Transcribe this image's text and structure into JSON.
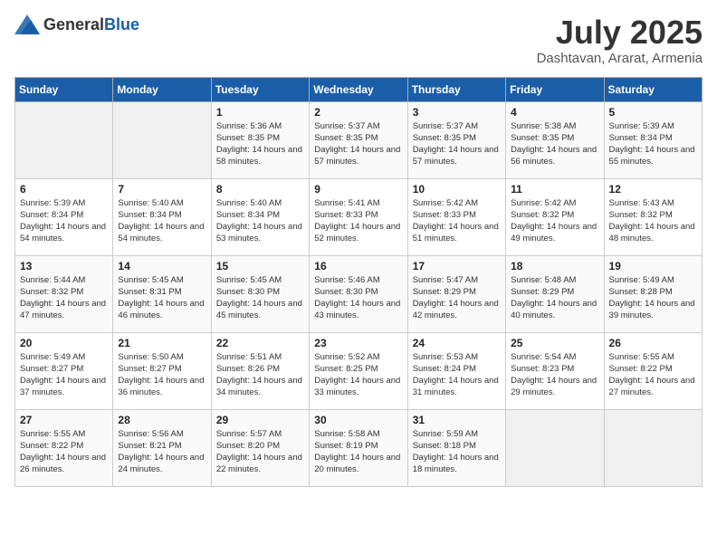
{
  "logo": {
    "general": "General",
    "blue": "Blue"
  },
  "header": {
    "month": "July 2025",
    "location": "Dashtavan, Ararat, Armenia"
  },
  "weekdays": [
    "Sunday",
    "Monday",
    "Tuesday",
    "Wednesday",
    "Thursday",
    "Friday",
    "Saturday"
  ],
  "weeks": [
    [
      {
        "day": "",
        "sunrise": "",
        "sunset": "",
        "daylight": ""
      },
      {
        "day": "",
        "sunrise": "",
        "sunset": "",
        "daylight": ""
      },
      {
        "day": "1",
        "sunrise": "Sunrise: 5:36 AM",
        "sunset": "Sunset: 8:35 PM",
        "daylight": "Daylight: 14 hours and 58 minutes."
      },
      {
        "day": "2",
        "sunrise": "Sunrise: 5:37 AM",
        "sunset": "Sunset: 8:35 PM",
        "daylight": "Daylight: 14 hours and 57 minutes."
      },
      {
        "day": "3",
        "sunrise": "Sunrise: 5:37 AM",
        "sunset": "Sunset: 8:35 PM",
        "daylight": "Daylight: 14 hours and 57 minutes."
      },
      {
        "day": "4",
        "sunrise": "Sunrise: 5:38 AM",
        "sunset": "Sunset: 8:35 PM",
        "daylight": "Daylight: 14 hours and 56 minutes."
      },
      {
        "day": "5",
        "sunrise": "Sunrise: 5:39 AM",
        "sunset": "Sunset: 8:34 PM",
        "daylight": "Daylight: 14 hours and 55 minutes."
      }
    ],
    [
      {
        "day": "6",
        "sunrise": "Sunrise: 5:39 AM",
        "sunset": "Sunset: 8:34 PM",
        "daylight": "Daylight: 14 hours and 54 minutes."
      },
      {
        "day": "7",
        "sunrise": "Sunrise: 5:40 AM",
        "sunset": "Sunset: 8:34 PM",
        "daylight": "Daylight: 14 hours and 54 minutes."
      },
      {
        "day": "8",
        "sunrise": "Sunrise: 5:40 AM",
        "sunset": "Sunset: 8:34 PM",
        "daylight": "Daylight: 14 hours and 53 minutes."
      },
      {
        "day": "9",
        "sunrise": "Sunrise: 5:41 AM",
        "sunset": "Sunset: 8:33 PM",
        "daylight": "Daylight: 14 hours and 52 minutes."
      },
      {
        "day": "10",
        "sunrise": "Sunrise: 5:42 AM",
        "sunset": "Sunset: 8:33 PM",
        "daylight": "Daylight: 14 hours and 51 minutes."
      },
      {
        "day": "11",
        "sunrise": "Sunrise: 5:42 AM",
        "sunset": "Sunset: 8:32 PM",
        "daylight": "Daylight: 14 hours and 49 minutes."
      },
      {
        "day": "12",
        "sunrise": "Sunrise: 5:43 AM",
        "sunset": "Sunset: 8:32 PM",
        "daylight": "Daylight: 14 hours and 48 minutes."
      }
    ],
    [
      {
        "day": "13",
        "sunrise": "Sunrise: 5:44 AM",
        "sunset": "Sunset: 8:32 PM",
        "daylight": "Daylight: 14 hours and 47 minutes."
      },
      {
        "day": "14",
        "sunrise": "Sunrise: 5:45 AM",
        "sunset": "Sunset: 8:31 PM",
        "daylight": "Daylight: 14 hours and 46 minutes."
      },
      {
        "day": "15",
        "sunrise": "Sunrise: 5:45 AM",
        "sunset": "Sunset: 8:30 PM",
        "daylight": "Daylight: 14 hours and 45 minutes."
      },
      {
        "day": "16",
        "sunrise": "Sunrise: 5:46 AM",
        "sunset": "Sunset: 8:30 PM",
        "daylight": "Daylight: 14 hours and 43 minutes."
      },
      {
        "day": "17",
        "sunrise": "Sunrise: 5:47 AM",
        "sunset": "Sunset: 8:29 PM",
        "daylight": "Daylight: 14 hours and 42 minutes."
      },
      {
        "day": "18",
        "sunrise": "Sunrise: 5:48 AM",
        "sunset": "Sunset: 8:29 PM",
        "daylight": "Daylight: 14 hours and 40 minutes."
      },
      {
        "day": "19",
        "sunrise": "Sunrise: 5:49 AM",
        "sunset": "Sunset: 8:28 PM",
        "daylight": "Daylight: 14 hours and 39 minutes."
      }
    ],
    [
      {
        "day": "20",
        "sunrise": "Sunrise: 5:49 AM",
        "sunset": "Sunset: 8:27 PM",
        "daylight": "Daylight: 14 hours and 37 minutes."
      },
      {
        "day": "21",
        "sunrise": "Sunrise: 5:50 AM",
        "sunset": "Sunset: 8:27 PM",
        "daylight": "Daylight: 14 hours and 36 minutes."
      },
      {
        "day": "22",
        "sunrise": "Sunrise: 5:51 AM",
        "sunset": "Sunset: 8:26 PM",
        "daylight": "Daylight: 14 hours and 34 minutes."
      },
      {
        "day": "23",
        "sunrise": "Sunrise: 5:52 AM",
        "sunset": "Sunset: 8:25 PM",
        "daylight": "Daylight: 14 hours and 33 minutes."
      },
      {
        "day": "24",
        "sunrise": "Sunrise: 5:53 AM",
        "sunset": "Sunset: 8:24 PM",
        "daylight": "Daylight: 14 hours and 31 minutes."
      },
      {
        "day": "25",
        "sunrise": "Sunrise: 5:54 AM",
        "sunset": "Sunset: 8:23 PM",
        "daylight": "Daylight: 14 hours and 29 minutes."
      },
      {
        "day": "26",
        "sunrise": "Sunrise: 5:55 AM",
        "sunset": "Sunset: 8:22 PM",
        "daylight": "Daylight: 14 hours and 27 minutes."
      }
    ],
    [
      {
        "day": "27",
        "sunrise": "Sunrise: 5:55 AM",
        "sunset": "Sunset: 8:22 PM",
        "daylight": "Daylight: 14 hours and 26 minutes."
      },
      {
        "day": "28",
        "sunrise": "Sunrise: 5:56 AM",
        "sunset": "Sunset: 8:21 PM",
        "daylight": "Daylight: 14 hours and 24 minutes."
      },
      {
        "day": "29",
        "sunrise": "Sunrise: 5:57 AM",
        "sunset": "Sunset: 8:20 PM",
        "daylight": "Daylight: 14 hours and 22 minutes."
      },
      {
        "day": "30",
        "sunrise": "Sunrise: 5:58 AM",
        "sunset": "Sunset: 8:19 PM",
        "daylight": "Daylight: 14 hours and 20 minutes."
      },
      {
        "day": "31",
        "sunrise": "Sunrise: 5:59 AM",
        "sunset": "Sunset: 8:18 PM",
        "daylight": "Daylight: 14 hours and 18 minutes."
      },
      {
        "day": "",
        "sunrise": "",
        "sunset": "",
        "daylight": ""
      },
      {
        "day": "",
        "sunrise": "",
        "sunset": "",
        "daylight": ""
      }
    ]
  ]
}
